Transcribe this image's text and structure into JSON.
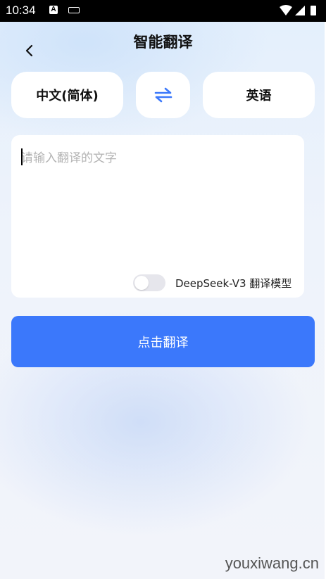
{
  "status_bar": {
    "time": "10:34",
    "notification_letter": "A"
  },
  "header": {
    "title": "智能翻译"
  },
  "languages": {
    "source": "中文(简体)",
    "target": "英语",
    "swap_icon": "swap-arrows-icon"
  },
  "input": {
    "placeholder": "请输入翻译的文字",
    "value": ""
  },
  "model_toggle": {
    "label": "DeepSeek-V3 翻译模型",
    "enabled": false
  },
  "actions": {
    "translate_label": "点击翻译"
  },
  "watermark": "youxiwang.cn",
  "colors": {
    "accent": "#3b78fb",
    "background": "#eef3fb"
  }
}
